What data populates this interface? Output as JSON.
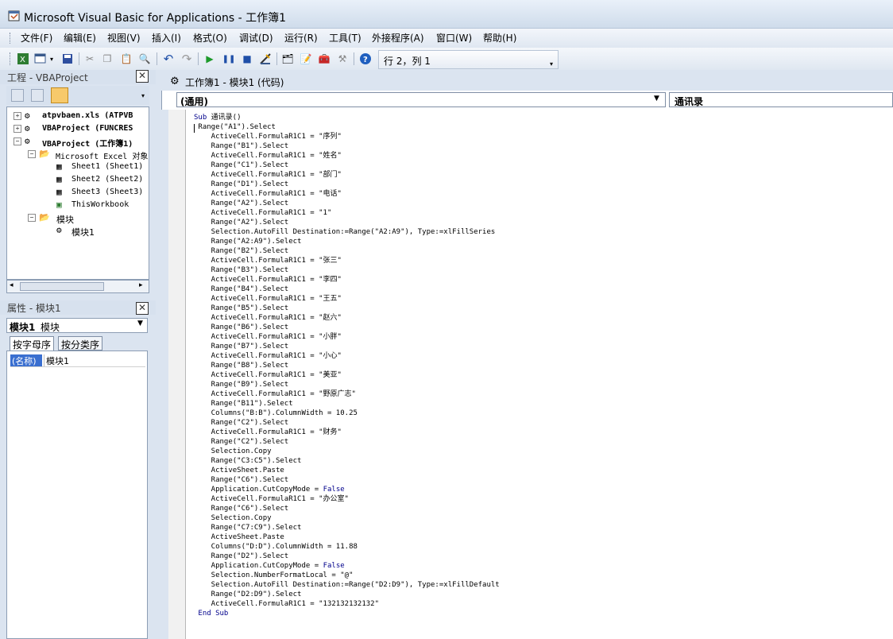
{
  "window": {
    "title": "Microsoft Visual Basic for Applications - 工作簿1"
  },
  "menu": [
    "文件(F)",
    "编辑(E)",
    "视图(V)",
    "插入(I)",
    "格式(O)",
    "调试(D)",
    "运行(R)",
    "工具(T)",
    "外接程序(A)",
    "窗口(W)",
    "帮助(H)"
  ],
  "toolbar": {
    "position": "行 2，列 1"
  },
  "project_panel": {
    "title": "工程 - VBAProject",
    "items": [
      {
        "label": "atpvbaen.xls (ATPVB",
        "bold": true,
        "expander": "+"
      },
      {
        "label": "VBAProject (FUNCRES",
        "bold": true,
        "expander": "+"
      },
      {
        "label": "VBAProject (工作簿1)",
        "bold": true,
        "expander": "-"
      },
      {
        "label": "Microsoft Excel 对象",
        "bold": false,
        "expander": "-"
      },
      {
        "label": "Sheet1 (Sheet1)",
        "bold": false
      },
      {
        "label": "Sheet2 (Sheet2)",
        "bold": false
      },
      {
        "label": "Sheet3 (Sheet3)",
        "bold": false
      },
      {
        "label": "ThisWorkbook",
        "bold": false
      },
      {
        "label": "模块",
        "bold": false,
        "expander": "-"
      },
      {
        "label": "模块1",
        "bold": false
      }
    ]
  },
  "properties_panel": {
    "title": "属性 - 模块1",
    "object_name": "模块1",
    "object_type": "模块",
    "tabs": [
      "按字母序",
      "按分类序"
    ],
    "rows": [
      {
        "name": "(名称)",
        "value": "模块1"
      }
    ]
  },
  "code_window": {
    "title": "工作簿1 - 模块1 (代码)",
    "object_combo": "(通用)",
    "proc_combo": "通讯录",
    "lines": [
      "Sub 通讯录()",
      " Range(\"A1\").Select",
      "    ActiveCell.FormulaR1C1 = \"序列\"",
      "    Range(\"B1\").Select",
      "    ActiveCell.FormulaR1C1 = \"姓名\"",
      "    Range(\"C1\").Select",
      "    ActiveCell.FormulaR1C1 = \"部门\"",
      "    Range(\"D1\").Select",
      "    ActiveCell.FormulaR1C1 = \"电话\"",
      "    Range(\"A2\").Select",
      "    ActiveCell.FormulaR1C1 = \"1\"",
      "    Range(\"A2\").Select",
      "    Selection.AutoFill Destination:=Range(\"A2:A9\"), Type:=xlFillSeries",
      "    Range(\"A2:A9\").Select",
      "    Range(\"B2\").Select",
      "    ActiveCell.FormulaR1C1 = \"张三\"",
      "    Range(\"B3\").Select",
      "    ActiveCell.FormulaR1C1 = \"李四\"",
      "    Range(\"B4\").Select",
      "    ActiveCell.FormulaR1C1 = \"王五\"",
      "    Range(\"B5\").Select",
      "    ActiveCell.FormulaR1C1 = \"赵六\"",
      "    Range(\"B6\").Select",
      "    ActiveCell.FormulaR1C1 = \"小胖\"",
      "    Range(\"B7\").Select",
      "    ActiveCell.FormulaR1C1 = \"小心\"",
      "    Range(\"B8\").Select",
      "    ActiveCell.FormulaR1C1 = \"美亚\"",
      "    Range(\"B9\").Select",
      "    ActiveCell.FormulaR1C1 = \"野原广志\"",
      "    Range(\"B11\").Select",
      "    Columns(\"B:B\").ColumnWidth = 10.25",
      "    Range(\"C2\").Select",
      "    ActiveCell.FormulaR1C1 = \"财务\"",
      "    Range(\"C2\").Select",
      "    Selection.Copy",
      "    Range(\"C3:C5\").Select",
      "    ActiveSheet.Paste",
      "    Range(\"C6\").Select",
      "    Application.CutCopyMode = False",
      "    ActiveCell.FormulaR1C1 = \"办公室\"",
      "    Range(\"C6\").Select",
      "    Selection.Copy",
      "    Range(\"C7:C9\").Select",
      "    ActiveSheet.Paste",
      "    Columns(\"D:D\").ColumnWidth = 11.88",
      "    Range(\"D2\").Select",
      "    Application.CutCopyMode = False",
      "    Selection.NumberFormatLocal = \"@\"",
      "    Selection.AutoFill Destination:=Range(\"D2:D9\"), Type:=xlFillDefault",
      "    Range(\"D2:D9\").Select",
      "    ActiveCell.FormulaR1C1 = \"132132132132\"",
      " End Sub"
    ]
  }
}
